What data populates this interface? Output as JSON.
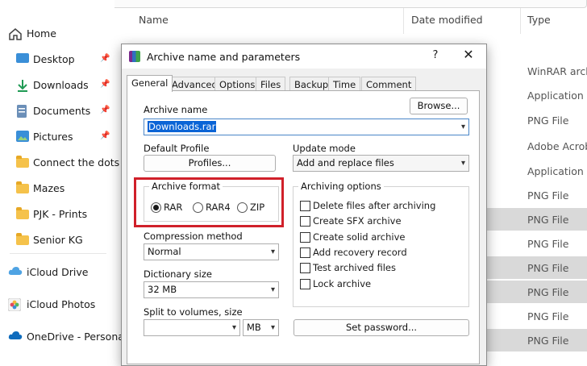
{
  "explorer": {
    "columns": {
      "name": "Name",
      "date_modified": "Date modified",
      "type": "Type"
    },
    "nav": [
      {
        "label": "Home",
        "icon": "home-icon"
      },
      {
        "label": "Desktop",
        "icon": "desktop-icon",
        "pinned": true
      },
      {
        "label": "Downloads",
        "icon": "downloads-icon",
        "pinned": true
      },
      {
        "label": "Documents",
        "icon": "documents-icon",
        "pinned": true
      },
      {
        "label": "Pictures",
        "icon": "pictures-icon",
        "pinned": true
      },
      {
        "label": "Connect the dots",
        "icon": "folder-icon"
      },
      {
        "label": "Mazes",
        "icon": "folder-icon"
      },
      {
        "label": "PJK - Prints",
        "icon": "folder-icon"
      },
      {
        "label": "Senior KG",
        "icon": "folder-icon"
      },
      {
        "label": "iCloud Drive",
        "icon": "icloud-icon"
      },
      {
        "label": "iCloud Photos",
        "icon": "icloud-photos-icon"
      },
      {
        "label": "OneDrive - Personal",
        "icon": "onedrive-icon"
      }
    ],
    "types": [
      "WinRAR archi",
      "Application",
      "PNG File",
      "Adobe Acroba",
      "Application",
      "PNG File",
      "PNG File",
      "PNG File",
      "PNG File",
      "PNG File",
      "PNG File",
      "PNG File"
    ]
  },
  "dialog": {
    "title": "Archive name and parameters",
    "help": "?",
    "close": "✕",
    "tabs": [
      "General",
      "Advanced",
      "Options",
      "Files",
      "Backup",
      "Time",
      "Comment"
    ],
    "archive_name_label": "Archive name",
    "archive_name_value": "Downloads.rar",
    "browse": "Browse...",
    "default_profile_label": "Default Profile",
    "profiles": "Profiles...",
    "update_mode_label": "Update mode",
    "update_mode_value": "Add and replace files",
    "archive_format_label": "Archive format",
    "formats": [
      {
        "label": "RAR",
        "selected": true
      },
      {
        "label": "RAR4",
        "selected": false
      },
      {
        "label": "ZIP",
        "selected": false
      }
    ],
    "archiving_options_label": "Archiving options",
    "options": [
      "Delete files after archiving",
      "Create SFX archive",
      "Create solid archive",
      "Add recovery record",
      "Test archived files",
      "Lock archive"
    ],
    "compression_method_label": "Compression method",
    "compression_method_value": "Normal",
    "dictionary_size_label": "Dictionary size",
    "dictionary_size_value": "32 MB",
    "split_label": "Split to volumes, size",
    "split_value": "",
    "split_unit": "MB",
    "set_password": "Set password..."
  },
  "colors": {
    "highlight": "#d0202a",
    "selection": "#0a64d6",
    "folder": "#f5c24b"
  }
}
